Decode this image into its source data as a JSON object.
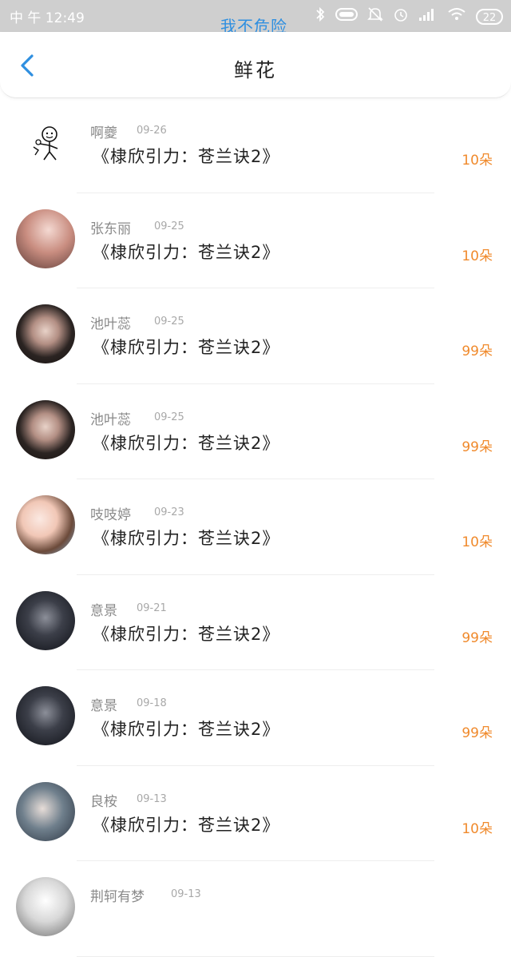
{
  "status_bar": {
    "time": "中 午 12:49",
    "center_text": "我不危险",
    "battery": "22"
  },
  "nav": {
    "title": "鲜花"
  },
  "rows": [
    {
      "name": "啊夔",
      "date": "09-26",
      "book": "《棣欣引力：苍兰诀2》",
      "amount": "10朵"
    },
    {
      "name": "张东丽",
      "date": "09-25",
      "book": "《棣欣引力：苍兰诀2》",
      "amount": "10朵"
    },
    {
      "name": "池叶蕊",
      "date": "09-25",
      "book": "《棣欣引力：苍兰诀2》",
      "amount": "99朵"
    },
    {
      "name": "池叶蕊",
      "date": "09-25",
      "book": "《棣欣引力：苍兰诀2》",
      "amount": "99朵"
    },
    {
      "name": "吱吱婷",
      "date": "09-23",
      "book": "《棣欣引力：苍兰诀2》",
      "amount": "10朵"
    },
    {
      "name": "意景",
      "date": "09-21",
      "book": "《棣欣引力：苍兰诀2》",
      "amount": "99朵"
    },
    {
      "name": "意景",
      "date": "09-18",
      "book": "《棣欣引力：苍兰诀2》",
      "amount": "99朵"
    },
    {
      "name": "良桉",
      "date": "09-13",
      "book": "《棣欣引力：苍兰诀2》",
      "amount": "10朵"
    },
    {
      "name": "荆轲有梦",
      "date": "09-13",
      "book": "",
      "amount": ""
    }
  ],
  "colors": {
    "accent_blue": "#2f8fe0",
    "amount_orange": "#f08a2c"
  }
}
